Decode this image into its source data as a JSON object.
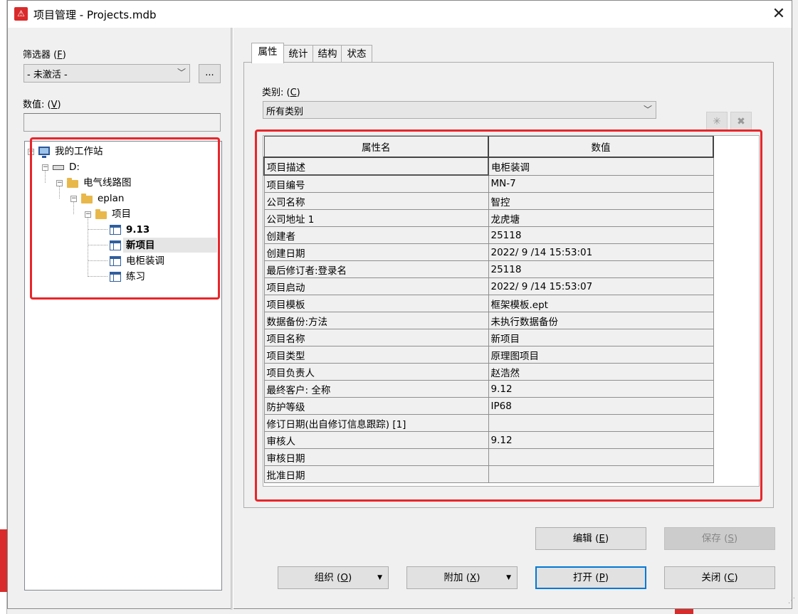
{
  "window": {
    "title": "项目管理 - Projects.mdb",
    "close_glyph": "✕"
  },
  "filter": {
    "label": "筛选器 (",
    "mnemonic": "F",
    "label_end": ")",
    "value": "- 未激活 -",
    "browse_label": "..."
  },
  "value_field": {
    "label": "数值: (",
    "mnemonic": "V",
    "label_end": ")",
    "value": ""
  },
  "tree": {
    "root": "我的工作站",
    "drive": "D:",
    "folder1": "电气线路图",
    "folder2": "eplan",
    "folder3": "项目",
    "projects": [
      "9.13",
      "新项目",
      "电柜装调",
      "练习"
    ]
  },
  "tabs": [
    "属性",
    "统计",
    "结构",
    "状态"
  ],
  "category": {
    "label": "类别: (",
    "mnemonic": "C",
    "label_end": ")",
    "value": "所有类别"
  },
  "toolbar": {
    "new_glyph": "✳",
    "delete_glyph": "✖"
  },
  "grid": {
    "headers": [
      "属性名",
      "数值"
    ],
    "rows": [
      [
        "项目描述",
        "电柜装调"
      ],
      [
        "项目编号",
        "MN-7"
      ],
      [
        "公司名称",
        "智控"
      ],
      [
        "公司地址 1",
        "龙虎塘"
      ],
      [
        "创建者",
        "25118"
      ],
      [
        "创建日期",
        "2022/ 9 /14 15:53:01"
      ],
      [
        "最后修订者:登录名",
        "25118"
      ],
      [
        "项目启动",
        "2022/ 9 /14 15:53:07"
      ],
      [
        "项目模板",
        "框架模板.ept"
      ],
      [
        "数据备份:方法",
        "未执行数据备份"
      ],
      [
        "项目名称",
        "新项目"
      ],
      [
        "项目类型",
        "原理图项目"
      ],
      [
        "项目负责人",
        "赵浩然"
      ],
      [
        "最终客户: 全称",
        "9.12"
      ],
      [
        "防护等级",
        "IP68"
      ],
      [
        "修订日期(出自修订信息跟踪) [1]",
        ""
      ],
      [
        "审核人",
        "9.12"
      ],
      [
        "审核日期",
        ""
      ],
      [
        "批准日期",
        ""
      ]
    ]
  },
  "buttons": {
    "edit": {
      "label": "编辑 (",
      "mn": "E",
      "end": ")"
    },
    "save": {
      "label": "保存 (",
      "mn": "S",
      "end": ")"
    },
    "organize": {
      "label": "组织 (",
      "mn": "O",
      "end": ")"
    },
    "attach": {
      "label": "附加 (",
      "mn": "X",
      "end": ")"
    },
    "open": {
      "label": "打开 (",
      "mn": "P",
      "end": ")"
    },
    "close": {
      "label": "关闭 (",
      "mn": "C",
      "end": ")"
    }
  }
}
